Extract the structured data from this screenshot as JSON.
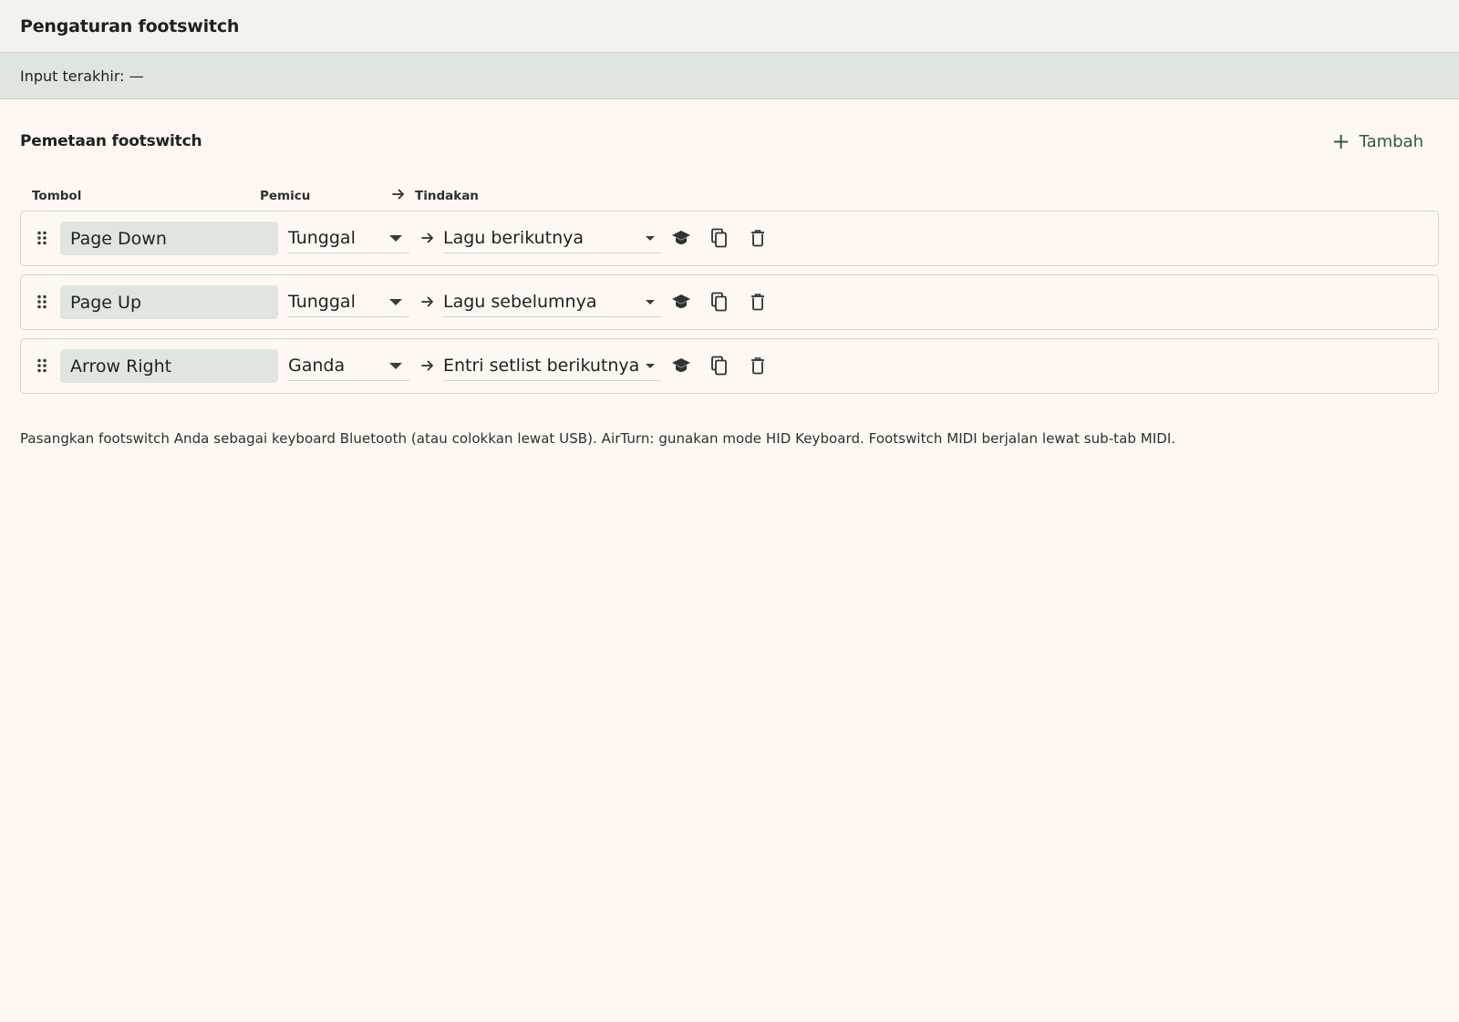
{
  "header": {
    "title": "Pengaturan footswitch"
  },
  "status": {
    "last_input": "Input terakhir: —"
  },
  "section": {
    "title": "Pemetaan footswitch",
    "add_label": "Tambah"
  },
  "columns": {
    "key": "Tombol",
    "trigger": "Pemicu",
    "action": "Tindakan"
  },
  "mappings": [
    {
      "key": "Page Down",
      "trigger": "Tunggal",
      "action": "Lagu berikutnya"
    },
    {
      "key": "Page Up",
      "trigger": "Tunggal",
      "action": "Lagu sebelumnya"
    },
    {
      "key": "Arrow Right",
      "trigger": "Ganda",
      "action": "Entri setlist berikutnya"
    }
  ],
  "hint": "Pasangkan footswitch Anda sebagai keyboard Bluetooth (atau colokkan lewat USB). AirTurn: gunakan mode HID Keyboard. Footswitch MIDI berjalan lewat sub-tab MIDI.",
  "icons": {
    "drag": "drag-handle-icon",
    "arrow": "arrow-right-icon",
    "learn": "learn-icon",
    "copy": "copy-icon",
    "delete": "delete-icon",
    "add": "plus-icon"
  },
  "colors": {
    "background": "#fff8f2",
    "title_bar": "#f3f2ee",
    "status_bar": "#dfe6df",
    "key_field": "#dfe6df",
    "accent": "#2f5a40",
    "text": "#1f211f"
  }
}
